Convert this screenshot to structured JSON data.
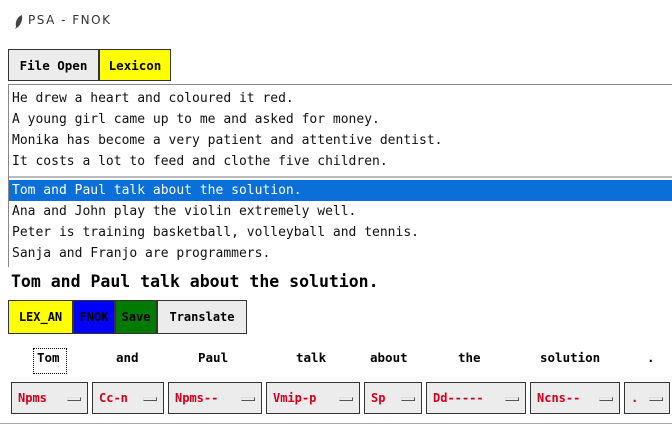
{
  "window": {
    "title": "PSA - FNOK",
    "icon": "feather-icon"
  },
  "menu": {
    "file_open": "File Open",
    "lexicon": "Lexicon"
  },
  "sentences": [
    "He drew a heart and coloured it red.",
    "A young girl came up to me and asked for money.",
    "Monika has become a very patient and attentive dentist.",
    "It costs a lot to feed and clothe five children.",
    "Tom and Paul talk about the solution.",
    "Ana and John play the violin extremely well.",
    "Peter is training basketball, volleyball and tennis.",
    "Sanja and Franjo are programmers."
  ],
  "selected_index": 4,
  "current_sentence": "Tom and Paul talk about the solution.",
  "toolbar": {
    "lex_an": "LEX_AN",
    "fnok": "FNOK",
    "save": "Save",
    "translate": "Translate"
  },
  "tokens": [
    "Tom",
    "and",
    "Paul",
    "talk",
    "about",
    "the",
    "solution",
    "."
  ],
  "tags": [
    "Npms",
    "Cc-n",
    "Npms--",
    "Vmip-p",
    "Sp",
    "Dd-----",
    "Ncns--",
    "."
  ],
  "colors": {
    "lexicon_bg": "#ffff00",
    "lex_an_bg": "#ffff00",
    "fnok_bg": "#0000ff",
    "save_bg": "#007a00",
    "selection": "#0a6fd8",
    "tag_text": "#d0001c"
  }
}
